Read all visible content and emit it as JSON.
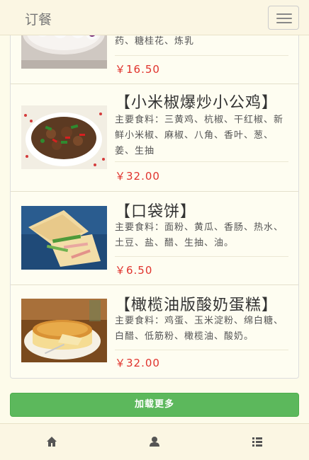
{
  "navbar": {
    "brand": "订餐",
    "menu_icon": "hamburger-menu-icon"
  },
  "dishes": [
    {
      "title": "",
      "ingredients": "药、糖桂花、炼乳",
      "price": "￥16.50",
      "image": "purple-rice-rolls-photo"
    },
    {
      "title": "【小米椒爆炒小公鸡】",
      "ingredients": "主要食料：三黄鸡、杭椒、干红椒、新鲜小米椒、麻椒、八角、香叶、葱、姜、生抽",
      "price": "￥32.00",
      "image": "stir-fried-chicken-photo"
    },
    {
      "title": "【口袋饼】",
      "ingredients": "主要食料：面粉、黄瓜、香肠、热水、土豆、盐、醋、生抽、油。",
      "price": "￥6.50",
      "image": "pocket-pancake-photo"
    },
    {
      "title": "【橄榄油版酸奶蛋糕】",
      "ingredients": "主要食料：鸡蛋、玉米淀粉、绵白糖、白醋、低筋粉、橄榄油、酸奶。",
      "price": "￥32.00",
      "image": "yogurt-cake-photo"
    }
  ],
  "load_more": {
    "label": "加载更多",
    "color": "#5cb85c"
  },
  "bottom_tabs": [
    {
      "icon": "home-icon"
    },
    {
      "icon": "user-icon"
    },
    {
      "icon": "list-icon"
    }
  ],
  "colors": {
    "price": "#e0332d",
    "background": "#fdfbea"
  }
}
